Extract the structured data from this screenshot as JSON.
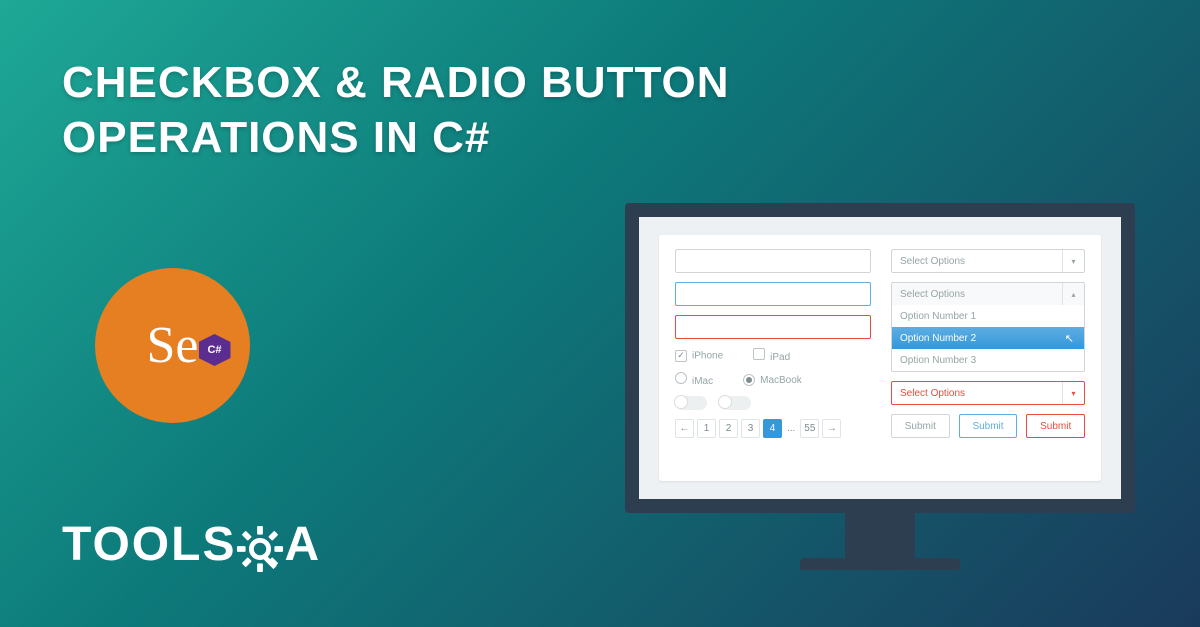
{
  "title": {
    "line1": "CHECKBOX & RADIO BUTTON",
    "line2": "OPERATIONS IN C#"
  },
  "badge": {
    "text": "Se",
    "lang": "C#"
  },
  "logo": {
    "part1": "TOOLS",
    "part2": "A"
  },
  "form": {
    "checkboxes": [
      {
        "label": "iPhone",
        "checked": true
      },
      {
        "label": "iPad",
        "checked": false
      }
    ],
    "radios": [
      {
        "label": "iMac",
        "checked": false
      },
      {
        "label": "MacBook",
        "checked": true
      }
    ],
    "pager": {
      "prev": "←",
      "pages": [
        "1",
        "2",
        "3",
        "4"
      ],
      "active": "4",
      "ellipsis": "...",
      "last": "55",
      "next": "→"
    },
    "select1": {
      "placeholder": "Select Options",
      "arrow": "▾"
    },
    "dropdown": {
      "header": "Select Options",
      "arrow": "▴",
      "options": [
        "Option Number 1",
        "Option Number 2",
        "Option Number 3"
      ],
      "selected": "Option Number 2"
    },
    "select2": {
      "placeholder": "Select Options",
      "arrow": "▾"
    },
    "buttons": [
      "Submit",
      "Submit",
      "Submit"
    ]
  }
}
